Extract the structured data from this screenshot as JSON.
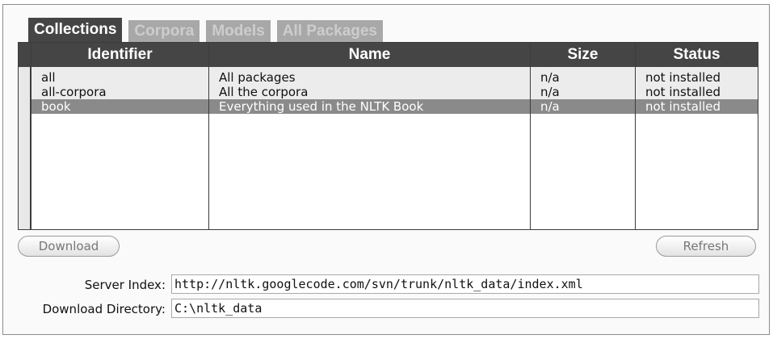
{
  "tabs": [
    "Collections",
    "Corpora",
    "Models",
    "All Packages"
  ],
  "table": {
    "headers": [
      "Identifier",
      "Name",
      "Size",
      "Status"
    ],
    "rows": [
      {
        "identifier": "all",
        "name": "All packages",
        "size": "n/a",
        "status": "not installed"
      },
      {
        "identifier": "all-corpora",
        "name": "All the corpora",
        "size": "n/a",
        "status": "not installed"
      },
      {
        "identifier": "book",
        "name": "Everything used in the NLTK Book",
        "size": "n/a",
        "status": "not installed"
      }
    ]
  },
  "buttons": {
    "download": "Download",
    "refresh": "Refresh"
  },
  "server_index": {
    "label": "Server Index:",
    "value": "http://nltk.googlecode.com/svn/trunk/nltk_data/index.xml"
  },
  "download_dir": {
    "label": "Download Directory:",
    "value": "C:\\nltk_data"
  }
}
